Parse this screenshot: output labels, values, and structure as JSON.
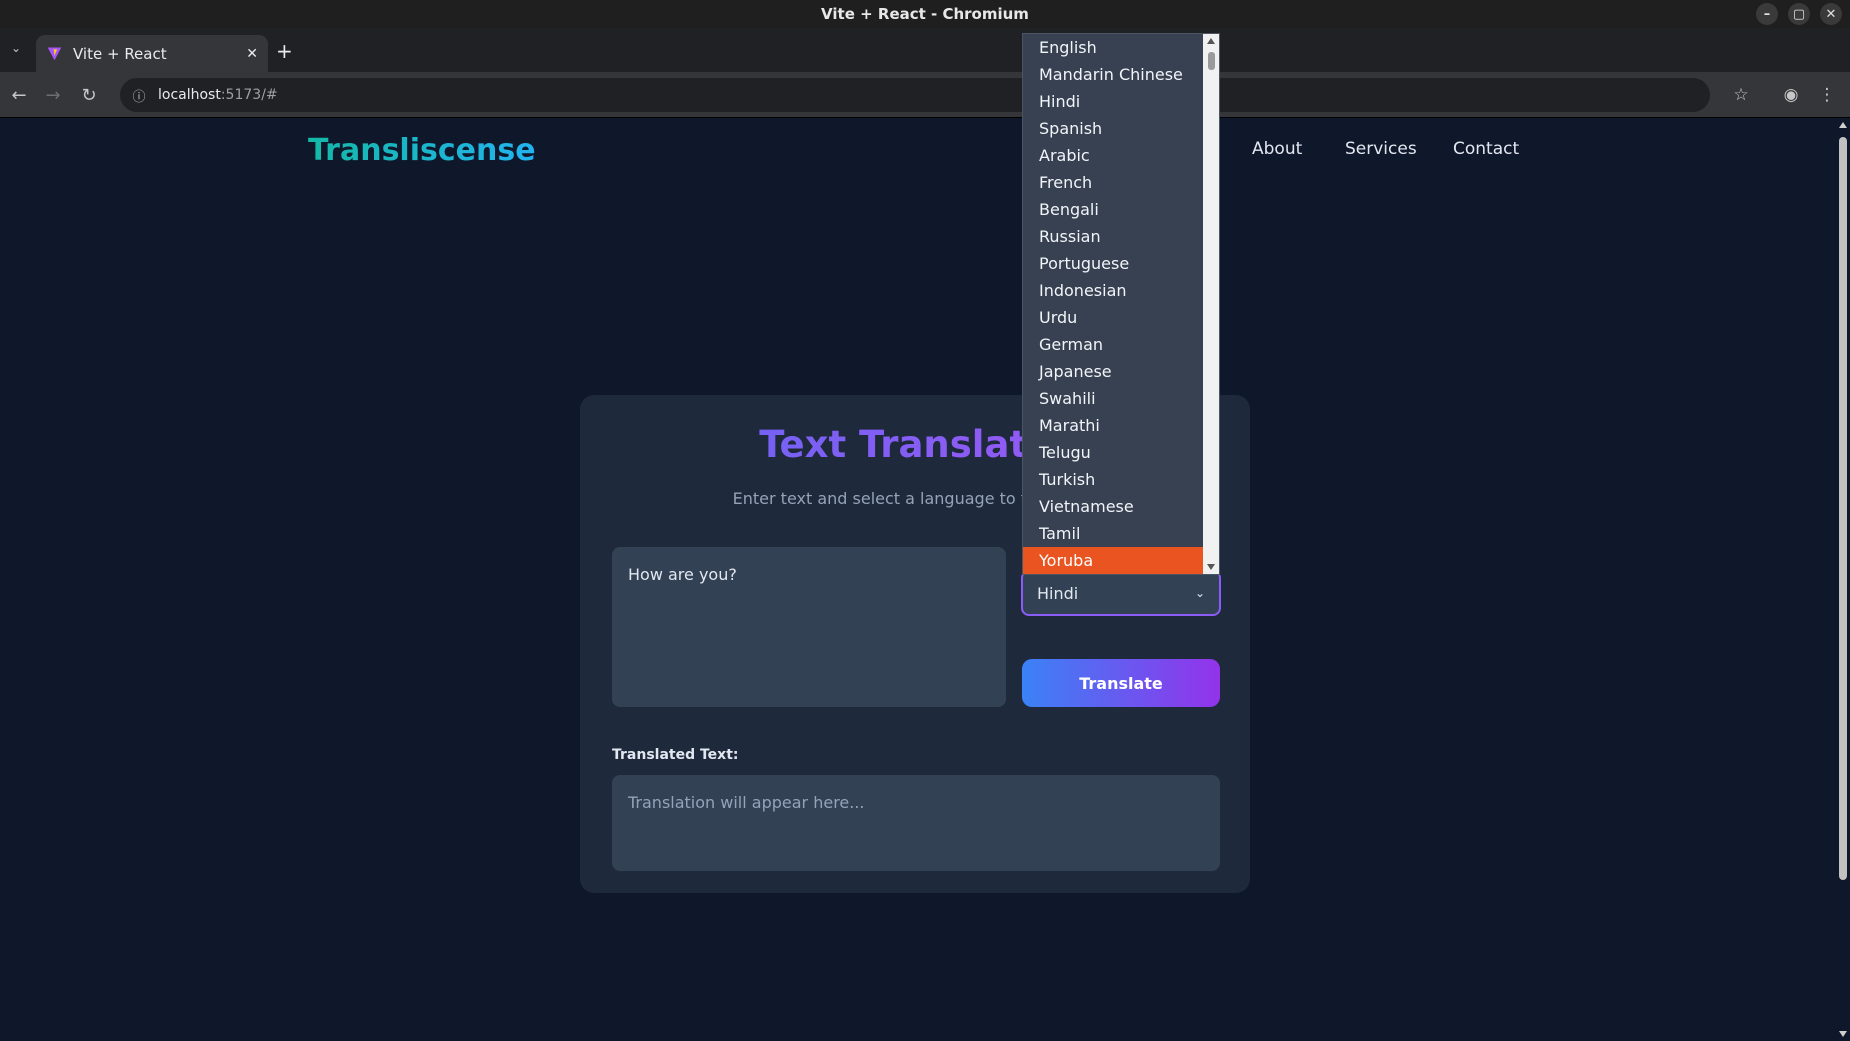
{
  "window": {
    "title": "Vite + React - Chromium"
  },
  "browser": {
    "tab_title": "Vite + React",
    "url_host": "localhost",
    "url_path": ":5173/#"
  },
  "site": {
    "logo": "Transliscense",
    "nav": [
      "About",
      "Services",
      "Contact"
    ]
  },
  "translator": {
    "title": "Text Translator",
    "subtitle": "Enter text and select a language to translate.",
    "input_value": "How are you?",
    "selected_language": "Hindi",
    "translate_button": "Translate",
    "output_label": "Translated Text:",
    "output_placeholder": "Translation will appear here..."
  },
  "dropdown": {
    "options": [
      "English",
      "Mandarin Chinese",
      "Hindi",
      "Spanish",
      "Arabic",
      "French",
      "Bengali",
      "Russian",
      "Portuguese",
      "Indonesian",
      "Urdu",
      "German",
      "Japanese",
      "Swahili",
      "Marathi",
      "Telugu",
      "Turkish",
      "Vietnamese",
      "Tamil",
      "Yoruba"
    ],
    "highlighted": "Yoruba"
  },
  "colors": {
    "page_bg": "#0f172a",
    "card_bg": "#1e293b",
    "field_bg": "#334155",
    "highlight": "#e95420",
    "select_border": "#8b5cf6"
  },
  "icons": {
    "back": "back-arrow-icon",
    "forward": "forward-arrow-icon",
    "reload": "reload-icon",
    "bookmark": "star-icon",
    "profile": "profile-icon",
    "menu": "kebab-menu-icon"
  }
}
